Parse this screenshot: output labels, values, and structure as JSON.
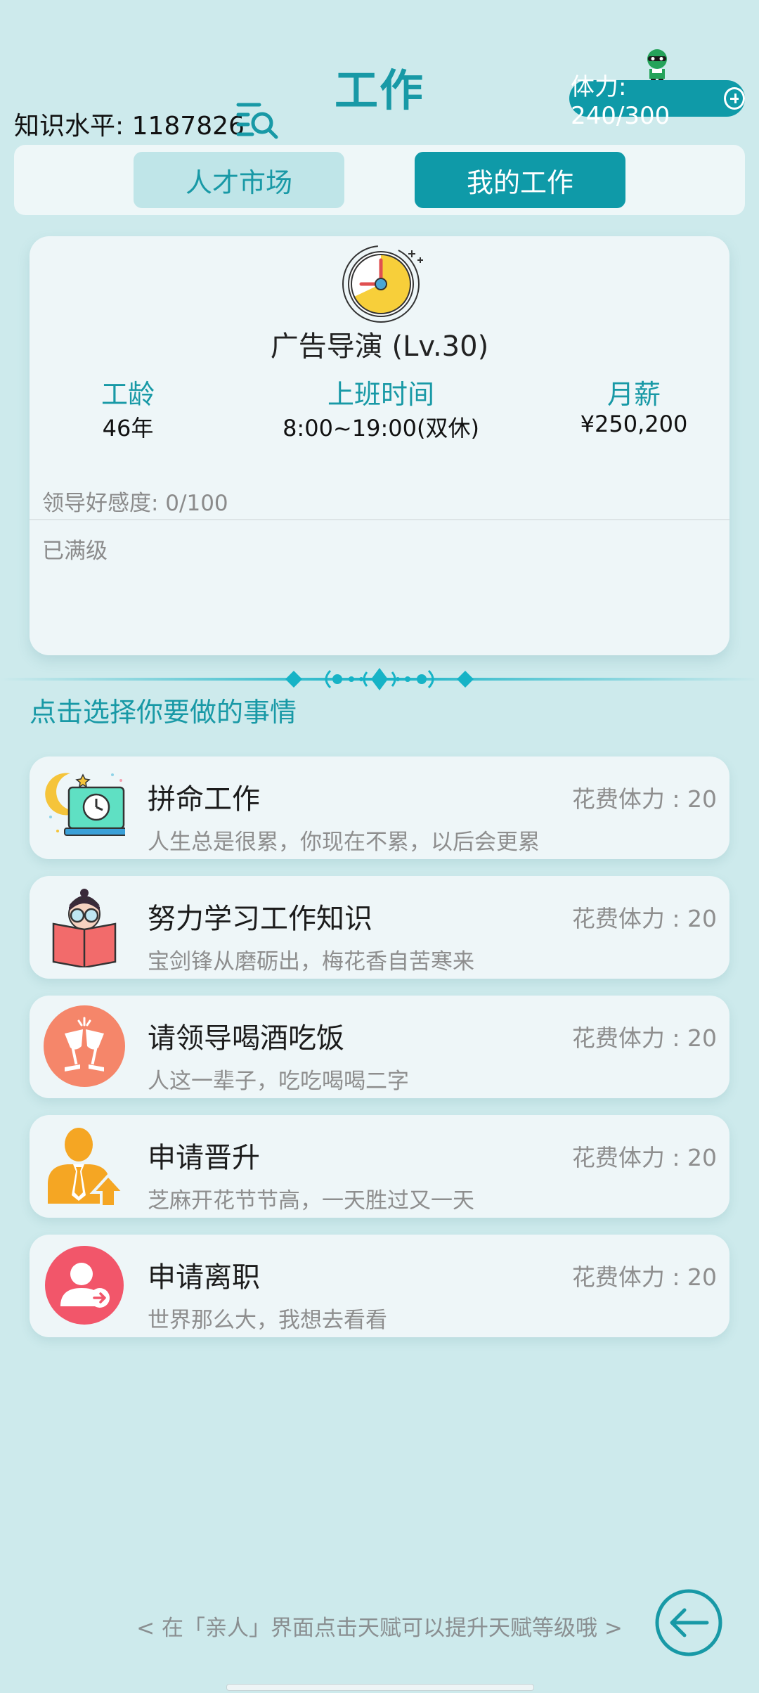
{
  "header": {
    "title": "工作",
    "knowledge": "知识水平: 1187826",
    "stamina": "体力: 240/300"
  },
  "tabs": {
    "market": "人才市场",
    "my_job": "我的工作"
  },
  "job": {
    "name": "广告导演 (Lv.30)",
    "stats": [
      {
        "label": "工龄",
        "value": "46年"
      },
      {
        "label": "上班时间",
        "value": "8:00~19:00(双休)"
      },
      {
        "label": "月薪",
        "value": "¥250,200"
      }
    ],
    "favor": "领导好感度: 0/100",
    "status": "已满级"
  },
  "section_heading": "点击选择你要做的事情",
  "actions": [
    {
      "title": "拼命工作",
      "cost": "花费体力 : 20",
      "subtitle": "人生总是很累，你现在不累，以后会更累",
      "icon": "moon-laptop-icon"
    },
    {
      "title": "努力学习工作知识",
      "cost": "花费体力 : 20",
      "subtitle": "宝剑锋从磨砺出，梅花香自苦寒来",
      "icon": "reading-book-icon"
    },
    {
      "title": "请领导喝酒吃饭",
      "cost": "花费体力 : 20",
      "subtitle": "人这一辈子，吃吃喝喝二字",
      "icon": "wine-glasses-icon"
    },
    {
      "title": "申请晋升",
      "cost": "花费体力 : 20",
      "subtitle": "芝麻开花节节高，一天胜过又一天",
      "icon": "promotion-icon"
    },
    {
      "title": "申请离职",
      "cost": "花费体力 : 20",
      "subtitle": "世界那么大，我想去看看",
      "icon": "resign-icon"
    }
  ],
  "footer_tip": "< 在「亲人」界面点击天赋可以提升天赋等级哦 >",
  "colors": {
    "accent": "#0f9aa8",
    "background": "#cdeaec",
    "card": "#eef6f8"
  }
}
